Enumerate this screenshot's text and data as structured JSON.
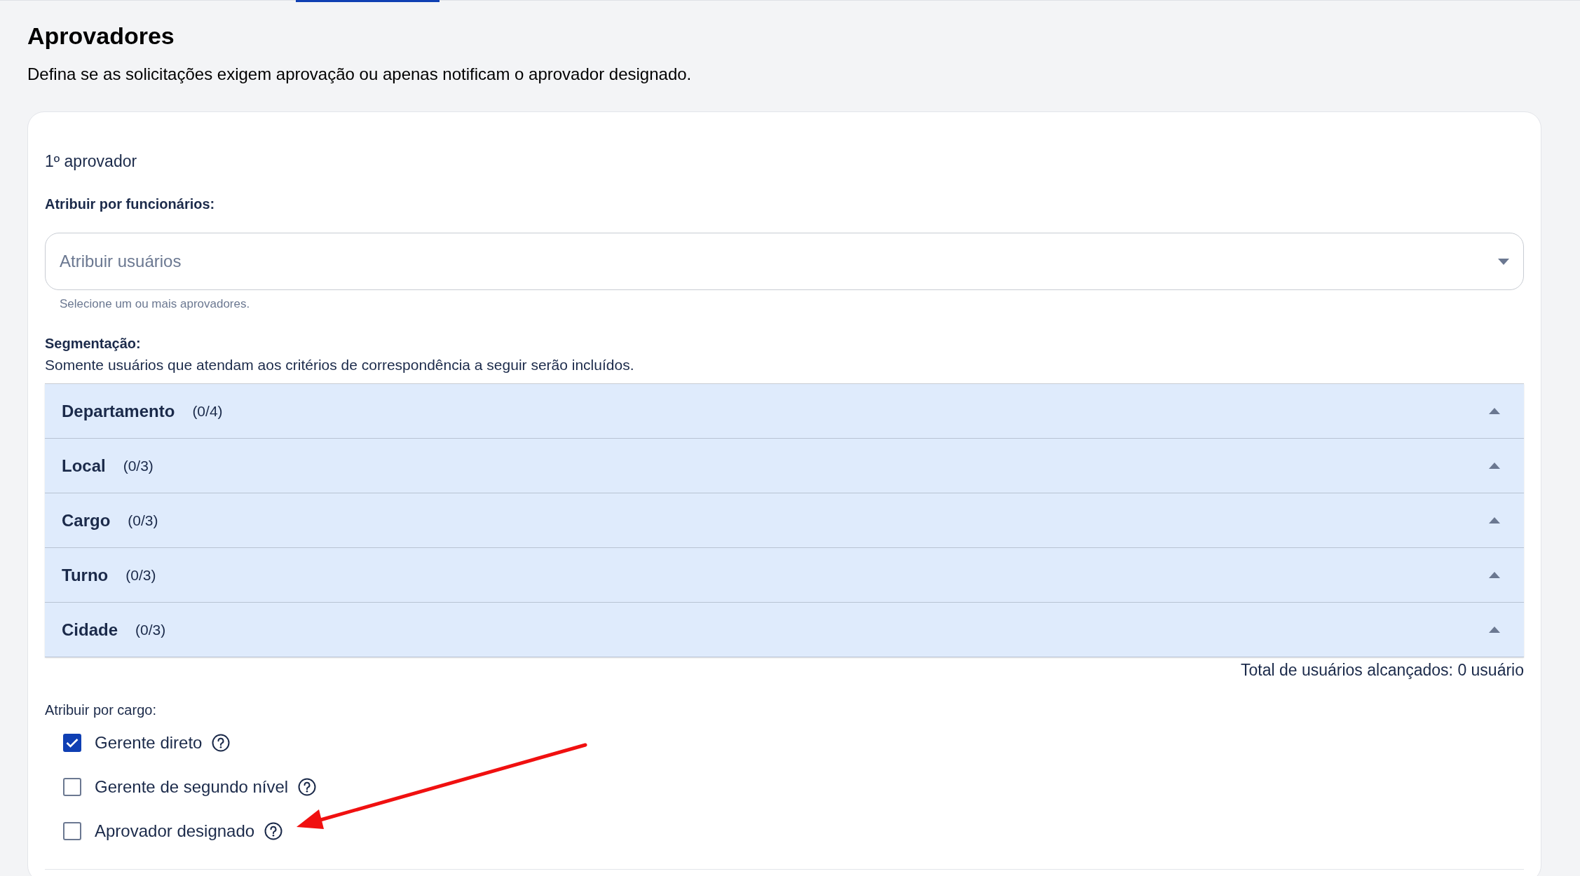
{
  "page": {
    "title": "Aprovadores",
    "subtitle": "Defina se as solicitações exigem aprovação ou apenas notificam o aprovador designado."
  },
  "approver": {
    "heading": "1º aprovador",
    "by_employee": {
      "label": "Atribuir por funcionários:",
      "placeholder": "Atribuir usuários",
      "helper": "Selecione um ou mais aprovadores."
    },
    "segmentation": {
      "label": "Segmentação:",
      "description": "Somente usuários que atendam aos critérios de correspondência a seguir serão incluídos.",
      "groups": [
        {
          "name": "Departamento",
          "count": "(0/4)"
        },
        {
          "name": "Local",
          "count": "(0/3)"
        },
        {
          "name": "Cargo",
          "count": "(0/3)"
        },
        {
          "name": "Turno",
          "count": "(0/3)"
        },
        {
          "name": "Cidade",
          "count": "(0/3)"
        }
      ],
      "total": "Total de usuários alcançados: 0 usuário"
    },
    "by_role": {
      "label": "Atribuir por cargo:",
      "options": [
        {
          "label": "Gerente direto",
          "checked": true
        },
        {
          "label": "Gerente de segundo nível",
          "checked": false
        },
        {
          "label": "Aprovador designado",
          "checked": false
        }
      ]
    }
  }
}
